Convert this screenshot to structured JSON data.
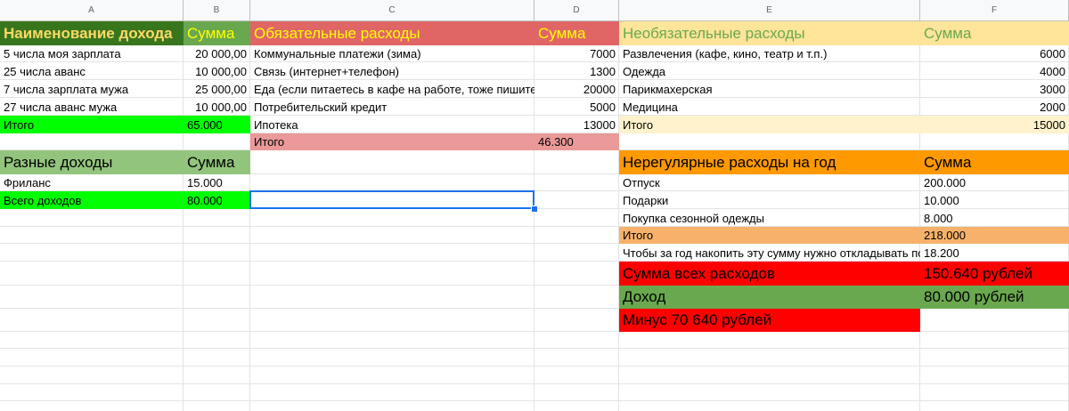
{
  "colors": {
    "dark_green": "#38761d",
    "light_green": "#93c47d",
    "bright_green": "#00ff00",
    "red_header": "#e06666",
    "red_total": "#ea9999",
    "light_yellow": "#ffe599",
    "orange": "#ff9900",
    "light_orange": "#f6b26b",
    "red": "#ff0000",
    "green": "#6aa84f",
    "yellow_text": "#ffd966"
  },
  "columns": [
    "A",
    "B",
    "C",
    "D",
    "E",
    "F"
  ],
  "income": {
    "header": "Наименование дохода",
    "sum_header": "Сумма",
    "rows": [
      {
        "name": "5 числа моя зарплата",
        "sum": "20 000,00"
      },
      {
        "name": "25 числа аванс",
        "sum": "10 000,00"
      },
      {
        "name": "7 числа зарплата мужа",
        "sum": "25 000,00"
      },
      {
        "name": "27 числа аванс мужа",
        "sum": "10 000,00"
      }
    ],
    "total_label": "Итого",
    "total_value": "65.000"
  },
  "mandatory": {
    "header": "Обязательные расходы",
    "sum_header": "Сумма",
    "rows": [
      {
        "name": "Коммунальные платежи (зима)",
        "sum": "7000"
      },
      {
        "name": "Связь (интернет+телефон)",
        "sum": "1300"
      },
      {
        "name": "Еда (если питаетесь в кафе на работе, тоже пишите)",
        "sum": "20000"
      },
      {
        "name": "Потребительский кредит",
        "sum": "5000"
      },
      {
        "name": "Ипотека",
        "sum": "13000"
      }
    ],
    "total_label": "Итого",
    "total_value": "46.300"
  },
  "optional": {
    "header": "Необязательные расходы",
    "sum_header": "Сумма",
    "rows": [
      {
        "name": "Развлечения (кафе, кино, театр и т.п.)",
        "sum": "6000"
      },
      {
        "name": "Одежда",
        "sum": "4000"
      },
      {
        "name": "Парикмахерская",
        "sum": "3000"
      },
      {
        "name": "Медицина",
        "sum": "2000"
      }
    ],
    "total_label": "Итого",
    "total_value": "15000"
  },
  "other_income": {
    "header": "Разные доходы",
    "sum_header": "Сумма",
    "rows": [
      {
        "name": "Фриланс",
        "sum": "15.000"
      }
    ],
    "total_label": "Всего доходов",
    "total_value": "80.000"
  },
  "irregular": {
    "header": "Нерегулярные расходы на год",
    "sum_header": "Сумма",
    "rows": [
      {
        "name": "Отпуск",
        "sum": "200.000"
      },
      {
        "name": "Подарки",
        "sum": "10.000"
      },
      {
        "name": "Покупка сезонной одежды",
        "sum": "8.000"
      }
    ],
    "total_label": "Итого",
    "total_value": "218.000",
    "monthly_label": "Чтобы за год накопить эту сумму нужно откладывать по",
    "monthly_value": "18.200"
  },
  "summary": {
    "expenses_label": "Сумма всех расходов",
    "expenses_value": "150.640 рублей",
    "income_label": "Доход",
    "income_value": "80.000 рублей",
    "balance_label": "Минус 70 640 рублей"
  }
}
